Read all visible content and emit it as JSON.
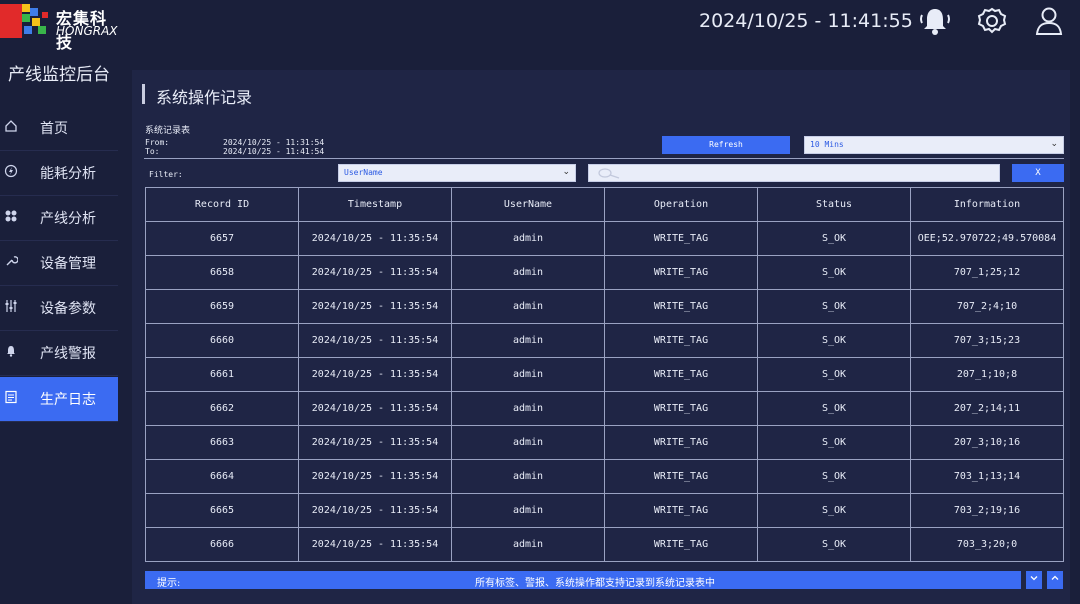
{
  "brand": {
    "name_cn": "宏集科技",
    "name_en": "HONGRAX"
  },
  "header": {
    "datetime": "2024/10/25 - 11:41:55",
    "icons": [
      "bell-icon",
      "gear-icon",
      "user-icon"
    ]
  },
  "sidebar": {
    "title": "产线监控后台",
    "items": [
      {
        "label": "首页",
        "icon": "home-icon",
        "active": false
      },
      {
        "label": "能耗分析",
        "icon": "energy-icon",
        "active": false
      },
      {
        "label": "产线分析",
        "icon": "grid-icon",
        "active": false
      },
      {
        "label": "设备管理",
        "icon": "wrench-icon",
        "active": false
      },
      {
        "label": "设备参数",
        "icon": "sliders-icon",
        "active": false
      },
      {
        "label": "产线警报",
        "icon": "alarm-icon",
        "active": false
      },
      {
        "label": "生产日志",
        "icon": "log-icon",
        "active": true
      }
    ]
  },
  "panel": {
    "title": "系统操作记录",
    "subtitle": "系统记录表",
    "from_label": "From:",
    "from_value": "2024/10/25 - 11:31:54",
    "to_label": "To:",
    "to_value": "2024/10/25 - 11:41:54",
    "refresh_label": "Refresh",
    "time_range_value": "10 Mins",
    "filter_label": "Filter:",
    "filter_field_value": "UserName",
    "search_value": "",
    "clear_label": "X"
  },
  "table": {
    "headers": [
      "Record ID",
      "Timestamp",
      "UserName",
      "Operation",
      "Status",
      "Information"
    ],
    "rows": [
      [
        "6657",
        "2024/10/25 - 11:35:54",
        "admin",
        "WRITE_TAG",
        "S_OK",
        "OEE;52.970722;49.570084"
      ],
      [
        "6658",
        "2024/10/25 - 11:35:54",
        "admin",
        "WRITE_TAG",
        "S_OK",
        "707_1;25;12"
      ],
      [
        "6659",
        "2024/10/25 - 11:35:54",
        "admin",
        "WRITE_TAG",
        "S_OK",
        "707_2;4;10"
      ],
      [
        "6660",
        "2024/10/25 - 11:35:54",
        "admin",
        "WRITE_TAG",
        "S_OK",
        "707_3;15;23"
      ],
      [
        "6661",
        "2024/10/25 - 11:35:54",
        "admin",
        "WRITE_TAG",
        "S_OK",
        "207_1;10;8"
      ],
      [
        "6662",
        "2024/10/25 - 11:35:54",
        "admin",
        "WRITE_TAG",
        "S_OK",
        "207_2;14;11"
      ],
      [
        "6663",
        "2024/10/25 - 11:35:54",
        "admin",
        "WRITE_TAG",
        "S_OK",
        "207_3;10;16"
      ],
      [
        "6664",
        "2024/10/25 - 11:35:54",
        "admin",
        "WRITE_TAG",
        "S_OK",
        "703_1;13;14"
      ],
      [
        "6665",
        "2024/10/25 - 11:35:54",
        "admin",
        "WRITE_TAG",
        "S_OK",
        "703_2;19;16"
      ],
      [
        "6666",
        "2024/10/25 - 11:35:54",
        "admin",
        "WRITE_TAG",
        "S_OK",
        "703_3;20;0"
      ]
    ]
  },
  "hint": {
    "label": "提示:",
    "message": "所有标签、警报、系统操作都支持记录到系统记录表中"
  },
  "colors": {
    "background": "#1a1f3a",
    "panel": "#1f2545",
    "accent": "#3b6bf2"
  }
}
